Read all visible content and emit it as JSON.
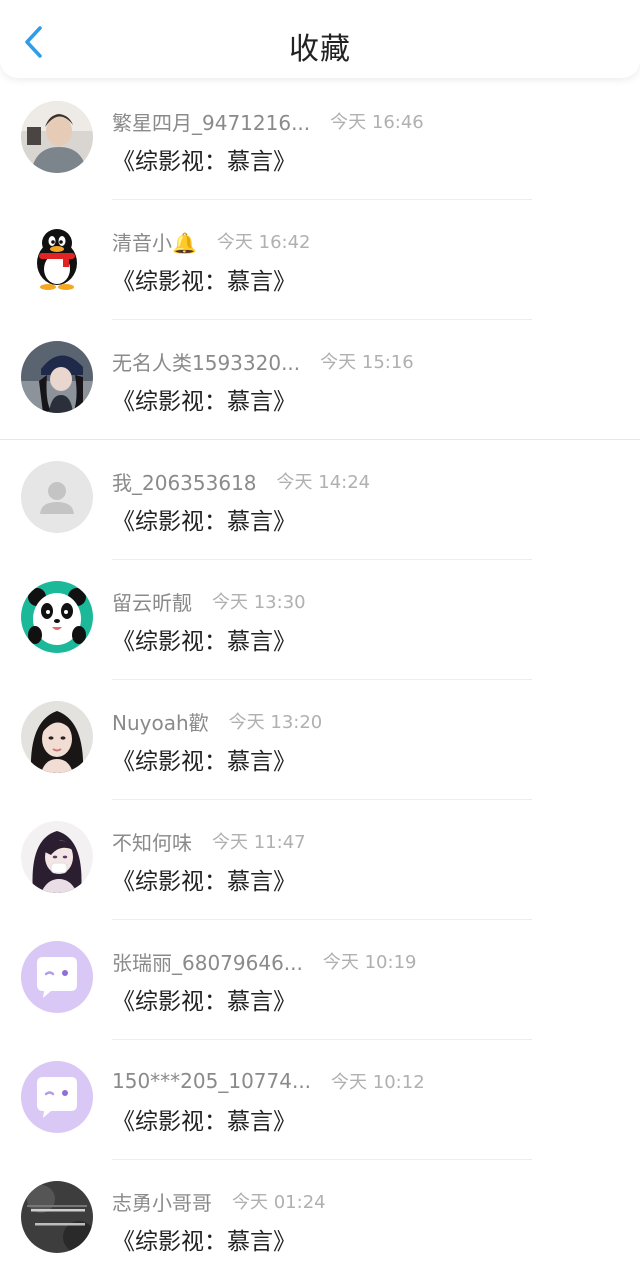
{
  "header": {
    "title": "收藏",
    "back_icon": "chevron-left-icon",
    "accent_color": "#2e9ce8"
  },
  "items": [
    {
      "name": "繁星四月_9471216...",
      "time": "今天 16:46",
      "title": "《综影视：慕言》",
      "avatar": "photo-avatar"
    },
    {
      "name": "清音小🔔",
      "time": "今天 16:42",
      "title": "《综影视：慕言》",
      "avatar": "qq-penguin-avatar"
    },
    {
      "name": "无名人类1593320...",
      "time": "今天 15:16",
      "title": "《综影视：慕言》",
      "avatar": "photo-avatar"
    },
    {
      "name": "我_206353618",
      "time": "今天 14:24",
      "title": "《综影视：慕言》",
      "avatar": "default-user-avatar"
    },
    {
      "name": "留云昕靓",
      "time": "今天 13:30",
      "title": "《综影视：慕言》",
      "avatar": "panda-avatar"
    },
    {
      "name": "Nuyoah歡",
      "time": "今天 13:20",
      "title": "《综影视：慕言》",
      "avatar": "photo-avatar"
    },
    {
      "name": "不知何味",
      "time": "今天 11:47",
      "title": "《综影视：慕言》",
      "avatar": "anime-avatar"
    },
    {
      "name": "张瑞丽_68079646...",
      "time": "今天 10:19",
      "title": "《综影视：慕言》",
      "avatar": "chat-bubble-avatar"
    },
    {
      "name": "150***205_10774...",
      "time": "今天 10:12",
      "title": "《综影视：慕言》",
      "avatar": "chat-bubble-avatar"
    },
    {
      "name": "志勇小哥哥",
      "time": "今天 01:24",
      "title": "《综影视：慕言》",
      "avatar": "text-photo-avatar"
    }
  ]
}
